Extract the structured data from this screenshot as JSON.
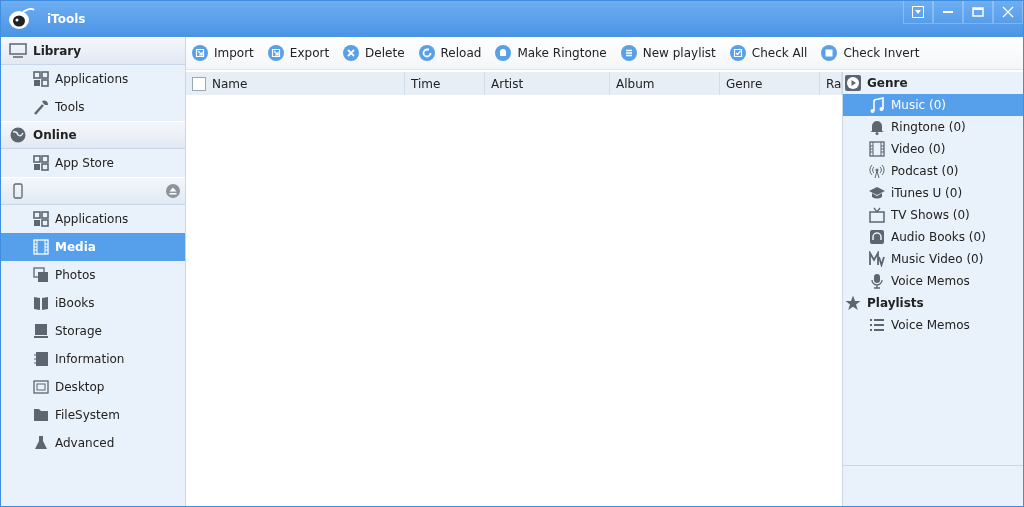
{
  "window": {
    "title": "iTools"
  },
  "sidebar": {
    "sections": [
      {
        "title": "Library",
        "items": [
          {
            "label": "Applications",
            "selected": false
          },
          {
            "label": "Tools",
            "selected": false
          }
        ]
      },
      {
        "title": "Online",
        "items": [
          {
            "label": "App Store",
            "selected": false
          }
        ]
      },
      {
        "items": [
          {
            "label": "Applications",
            "selected": false
          },
          {
            "label": "Media",
            "selected": true
          },
          {
            "label": "Photos",
            "selected": false
          },
          {
            "label": "iBooks",
            "selected": false
          },
          {
            "label": "Storage",
            "selected": false
          },
          {
            "label": "Information",
            "selected": false
          },
          {
            "label": "Desktop",
            "selected": false
          },
          {
            "label": "FileSystem",
            "selected": false
          },
          {
            "label": "Advanced",
            "selected": false
          }
        ]
      }
    ]
  },
  "toolbar": [
    "Import",
    "Export",
    "Delete",
    "Reload",
    "Make Ringtone",
    "New playlist",
    "Check All",
    "Check Invert"
  ],
  "table": {
    "select_all_checked": false,
    "columns": [
      "Name",
      "Time",
      "Artist",
      "Album",
      "Genre",
      "Ra"
    ]
  },
  "right_panel": {
    "sections": [
      {
        "title": "Genre",
        "items": [
          {
            "label": "Music (0)",
            "selected": true
          },
          {
            "label": "Ringtone (0)",
            "selected": false
          },
          {
            "label": "Video (0)",
            "selected": false
          },
          {
            "label": "Podcast (0)",
            "selected": false
          },
          {
            "label": "iTunes U (0)",
            "selected": false
          },
          {
            "label": "TV Shows (0)",
            "selected": false
          },
          {
            "label": "Audio Books (0)",
            "selected": false
          },
          {
            "label": "Music Video (0)",
            "selected": false
          },
          {
            "label": "Voice Memos",
            "selected": false
          }
        ]
      },
      {
        "title": "Playlists",
        "items": [
          {
            "label": "Voice Memos",
            "selected": false
          }
        ]
      }
    ]
  }
}
